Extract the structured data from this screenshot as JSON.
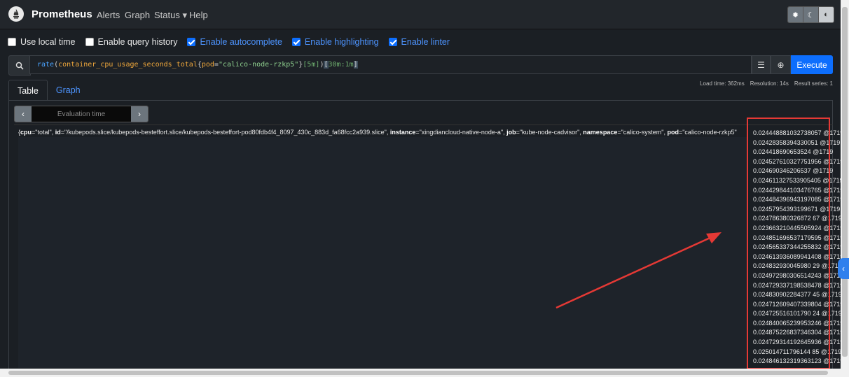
{
  "nav": {
    "brand": "Prometheus",
    "links": [
      "Alerts",
      "Graph",
      "Status ▾",
      "Help"
    ],
    "theme_icons": [
      "sun-icon",
      "moon-icon",
      "contrast-icon"
    ]
  },
  "options": [
    {
      "label": "Use local time",
      "checked": false
    },
    {
      "label": "Enable query history",
      "checked": false
    },
    {
      "label": "Enable autocomplete",
      "checked": true
    },
    {
      "label": "Enable highlighting",
      "checked": true
    },
    {
      "label": "Enable linter",
      "checked": true
    }
  ],
  "query": {
    "fn": "rate",
    "metric": "container_cpu_usage_seconds_total",
    "label_name": "pod",
    "label_value": "\"calico-node-rzkp5\"",
    "range": "[5m]",
    "subquery": "30m:1m",
    "execute_label": "Execute"
  },
  "tabs": [
    "Table",
    "Graph"
  ],
  "stats": {
    "load_time": "Load time: 362ms",
    "resolution": "Resolution: 14s",
    "result_series": "Result series: 1"
  },
  "eval": {
    "placeholder": "Evaluation time"
  },
  "series": {
    "open": "{",
    "cpu_key": "cpu",
    "cpu_val": "=\"total\", ",
    "id_key": "id",
    "id_val": "=\"/kubepods.slice/kubepods-besteffort.slice/kubepods-besteffort-pod80fdb4f4_8097_430c_883d_fa68fcc2a939.slice\", ",
    "instance_key": "instance",
    "instance_val": "=\"xingdiancloud-native-node-a\", ",
    "job_key": "job",
    "job_val": "=\"kube-node-cadvisor\", ",
    "ns_key": "namespace",
    "ns_val": "=\"calico-system\", ",
    "pod_key": "pod",
    "pod_val": "=\"calico-node-rzkp5\""
  },
  "values": [
    "0.024448881032738057 @1719",
    "0.02428358394330051 @1719",
    "0.024418690653524 @1719",
    "0.024527610327751956 @1719",
    "0.024690346206537 @1719",
    "0.024611327533905405 @1719",
    "0.024429844103476765 @1719",
    "0.024484396943197085 @1719",
    "0.02457954393199671 @1719",
    "0.024786380326872 67 @1719",
    "0.023663210445505924 @1719",
    "0.024851696537179595 @1719",
    "0.024565337344255832 @1719",
    "0.024613936089941408 @1719",
    "0.024832930045980 29 @1719",
    "0.024972980306514243 @1719",
    "0.024729337198538478 @1719",
    "0.024830902284377 45 @1719",
    "0.024712609407339804 @1719",
    "0.024725516101790 24 @1719",
    "0.024840065239953246 @1719",
    "0.024875226837346304 @1719",
    "0.024729314192645936 @1719",
    "0.025014711796144 85 @1719",
    "0.024846132319363123 @1719"
  ],
  "colors": {
    "accent": "#0d6efd",
    "highlight_box": "#e53935",
    "background": "#1b1f24"
  }
}
